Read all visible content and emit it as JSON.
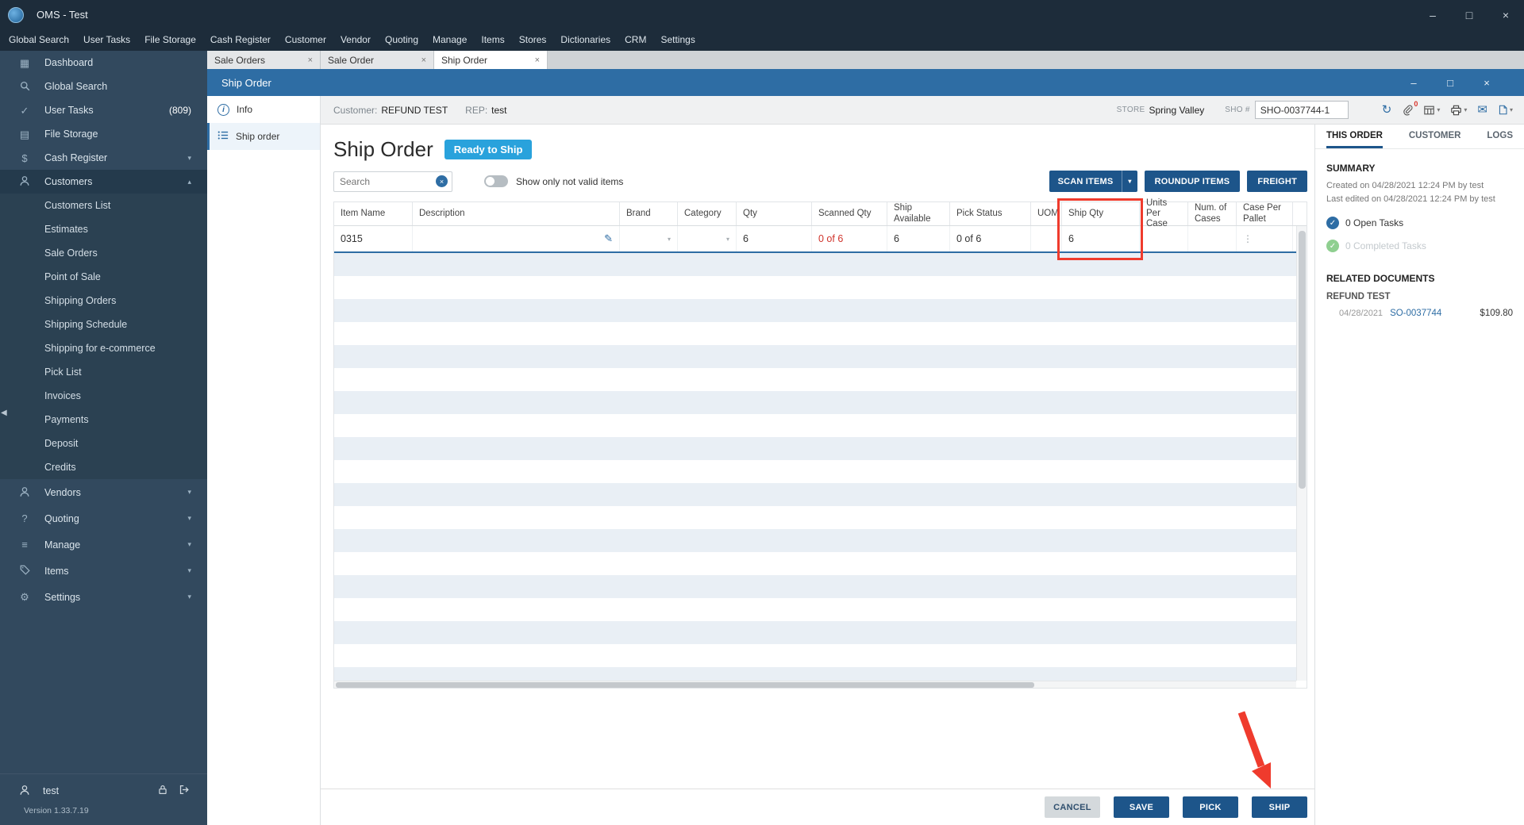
{
  "app": {
    "title": "OMS - Test"
  },
  "menu": {
    "items": [
      "Global Search",
      "User Tasks",
      "File Storage",
      "Cash Register",
      "Customer",
      "Vendor",
      "Quoting",
      "Manage",
      "Items",
      "Stores",
      "Dictionaries",
      "CRM",
      "Settings"
    ]
  },
  "sidebar": {
    "top": [
      {
        "label": "Dashboard"
      },
      {
        "label": "Global Search"
      },
      {
        "label": "User Tasks",
        "badge": "(809)"
      },
      {
        "label": "File Storage"
      },
      {
        "label": "Cash Register"
      },
      {
        "label": "Customers"
      }
    ],
    "customers_children": [
      "Customers List",
      "Estimates",
      "Sale Orders",
      "Point of Sale",
      "Shipping Orders",
      "Shipping Schedule",
      "Shipping for e-commerce",
      "Pick List",
      "Invoices",
      "Payments",
      "Deposit",
      "Credits"
    ],
    "groups": [
      {
        "label": "Vendors"
      },
      {
        "label": "Quoting"
      },
      {
        "label": "Manage"
      },
      {
        "label": "Items"
      },
      {
        "label": "Settings"
      }
    ],
    "user": "test",
    "version": "Version 1.33.7.19"
  },
  "tabs": {
    "items": [
      {
        "label": "Sale Orders"
      },
      {
        "label": "Sale Order"
      },
      {
        "label": "Ship Order"
      }
    ]
  },
  "inner_window": {
    "title": "Ship Order"
  },
  "subheader": {
    "customer_label": "Customer:",
    "customer_value": "REFUND TEST",
    "rep_label": "REP:",
    "rep_value": "test",
    "store_label": "STORE",
    "store_value": "Spring Valley",
    "sho_label": "SHO #",
    "sho_value": "SHO-0037744-1",
    "attachment_count": "0"
  },
  "nav": {
    "info": "Info",
    "ship_order": "Ship order"
  },
  "page": {
    "title": "Ship Order",
    "status_badge": "Ready to Ship",
    "search_placeholder": "Search",
    "toggle_label": "Show only not valid items",
    "scan_button": "SCAN ITEMS",
    "roundup_button": "ROUNDUP ITEMS",
    "freight_button": "FREIGHT"
  },
  "table": {
    "columns": [
      "Item Name",
      "Description",
      "Brand",
      "Category",
      "Qty",
      "Scanned Qty",
      "Ship Available",
      "Pick Status",
      "UOM",
      "Ship Qty",
      "Units Per Case",
      "Num. of Cases",
      "Case Per Pallet"
    ],
    "row": {
      "item_name": "0315",
      "description": "",
      "qty": "6",
      "scanned_qty": "0 of 6",
      "ship_available": "6",
      "pick_status": "0 of 6",
      "uom": "",
      "ship_qty": "6",
      "units_per_case": "",
      "num_of_cases": "",
      "case_per_pallet": ""
    }
  },
  "right_panel": {
    "tabs": [
      "THIS ORDER",
      "CUSTOMER",
      "LOGS"
    ],
    "summary_title": "SUMMARY",
    "created": "Created on 04/28/2021 12:24 PM by test",
    "last_edited": "Last edited on 04/28/2021 12:24 PM by test",
    "open_tasks": "0 Open Tasks",
    "completed_tasks": "0 Completed Tasks",
    "related_title": "RELATED DOCUMENTS",
    "related_customer": "REFUND TEST",
    "doc_date": "04/28/2021",
    "doc_number": "SO-0037744",
    "doc_amount": "$109.80"
  },
  "footer": {
    "cancel": "CANCEL",
    "save": "SAVE",
    "pick": "PICK",
    "ship": "SHIP"
  },
  "icons": {
    "close": "×",
    "minimize": "–",
    "maximize": "□",
    "chevron_down": "▾",
    "chevron_up": "▴",
    "check": "✓",
    "dots": "⋮",
    "pencil": "✎",
    "mail": "✉",
    "sync": "↻",
    "gear": "⚙",
    "menu": "≡",
    "grid": "▦",
    "rows": "▤",
    "collapse_left": "◀",
    "dollar": "$",
    "info": "i",
    "question": "?"
  },
  "colors": {
    "accent_blue": "#2e6da4",
    "button_blue": "#1d558a",
    "badge_blue": "#29a2dc",
    "annotation_red": "#ef3b2d",
    "danger_text": "#d0342c",
    "sidebar_bg": "#32495e",
    "titlebar_bg": "#1d2c3a"
  }
}
